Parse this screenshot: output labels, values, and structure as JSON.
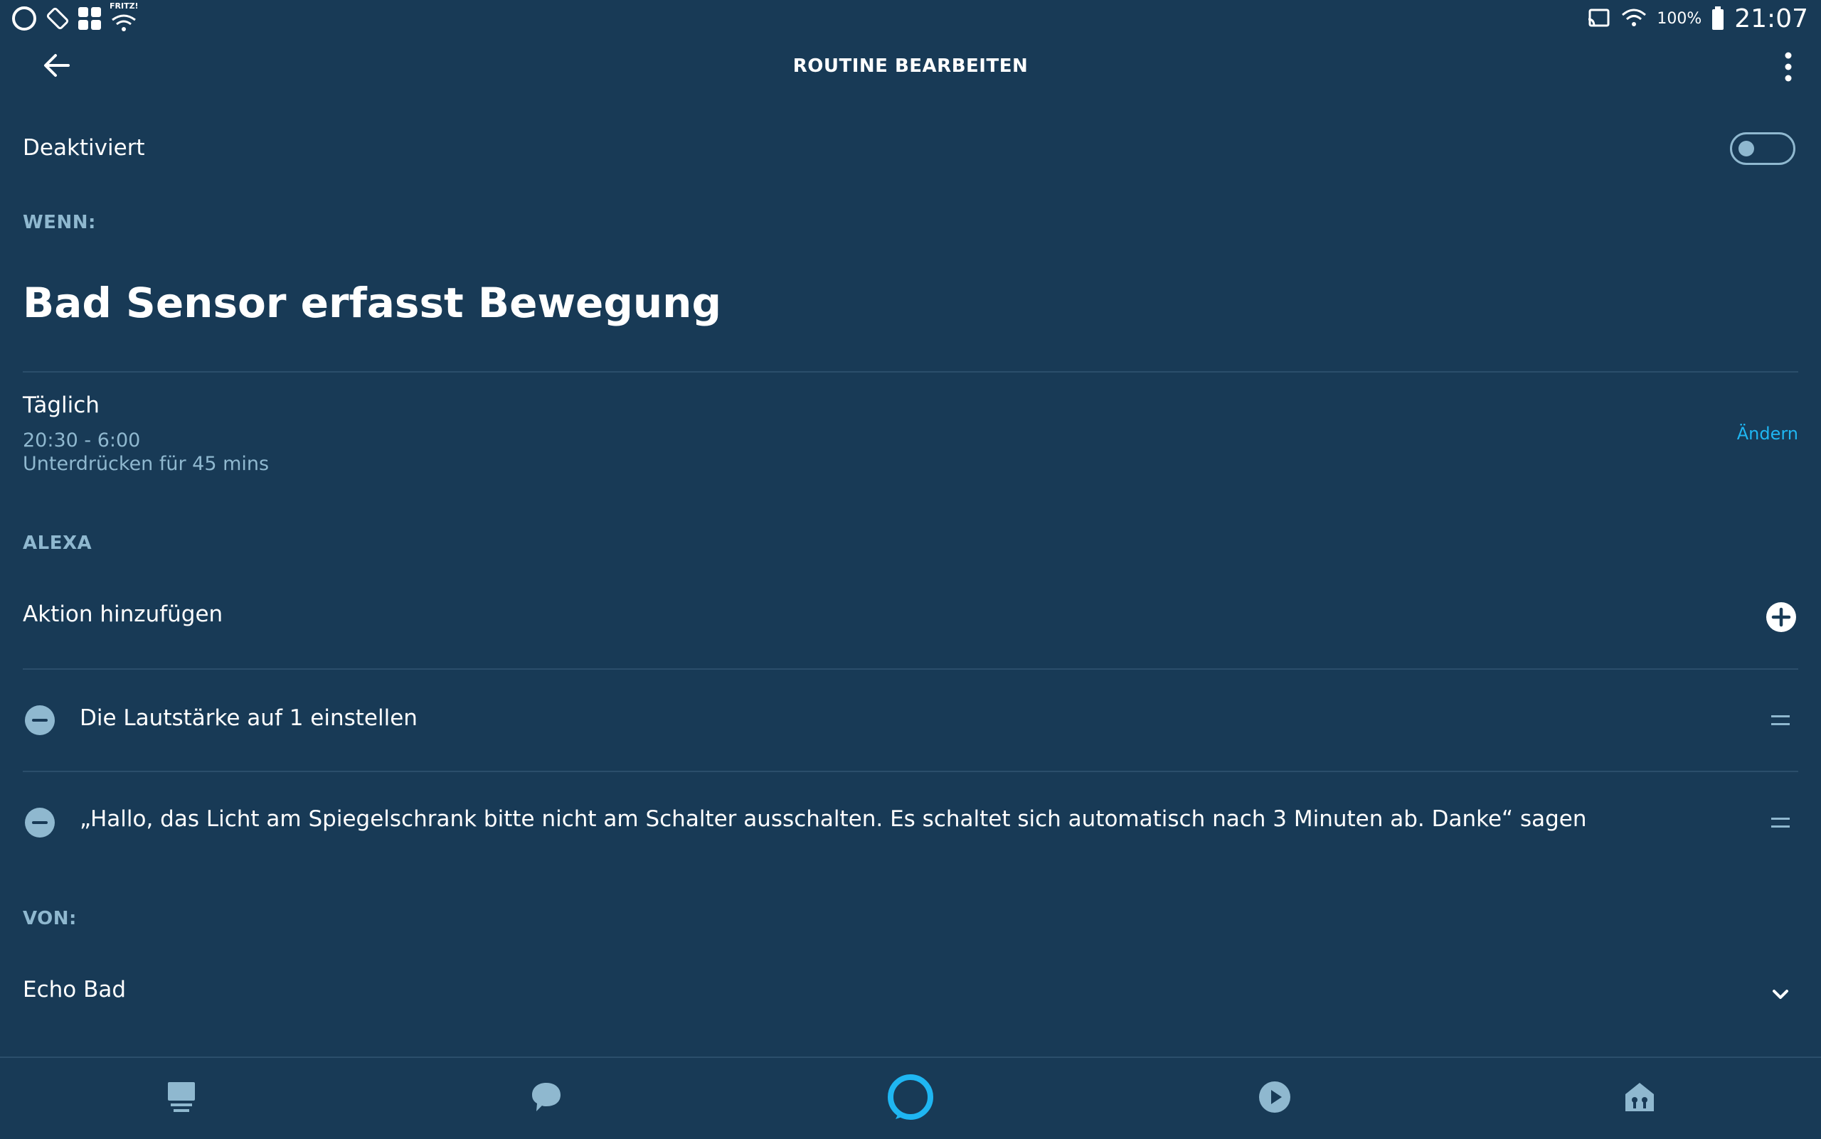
{
  "status_bar": {
    "battery_percent": "100%",
    "time": "21:07",
    "wifi_label": "FRITZ!"
  },
  "header": {
    "title": "ROUTINE BEARBEITEN"
  },
  "routine": {
    "enabled_label": "Deaktiviert",
    "enabled": false
  },
  "when": {
    "section_label": "WENN:",
    "trigger": "Bad Sensor erfasst Bewegung",
    "schedule_title": "Täglich",
    "schedule_time": "20:30 - 6:00",
    "suppress": "Unterdrücken für 45 mins",
    "change_label": "Ändern"
  },
  "alexa": {
    "section_label": "ALEXA",
    "add_action_label": "Aktion hinzufügen",
    "actions": [
      "Die Lautstärke auf 1 einstellen",
      "„Hallo, das Licht am Spiegelschrank bitte nicht am Schalter ausschalten. Es schaltet sich automatisch nach 3 Minuten ab. Danke“ sagen"
    ]
  },
  "from": {
    "section_label": "VON:",
    "device": "Echo Bad"
  },
  "colors": {
    "background": "#183a56",
    "muted": "#8fb8cf",
    "accent": "#1fb6f2",
    "divider": "#2b4e6b"
  },
  "bottom_nav": [
    {
      "icon": "home-icon"
    },
    {
      "icon": "chat-bubble-icon"
    },
    {
      "icon": "alexa-ring-icon"
    },
    {
      "icon": "play-icon"
    },
    {
      "icon": "smart-home-icon"
    }
  ]
}
